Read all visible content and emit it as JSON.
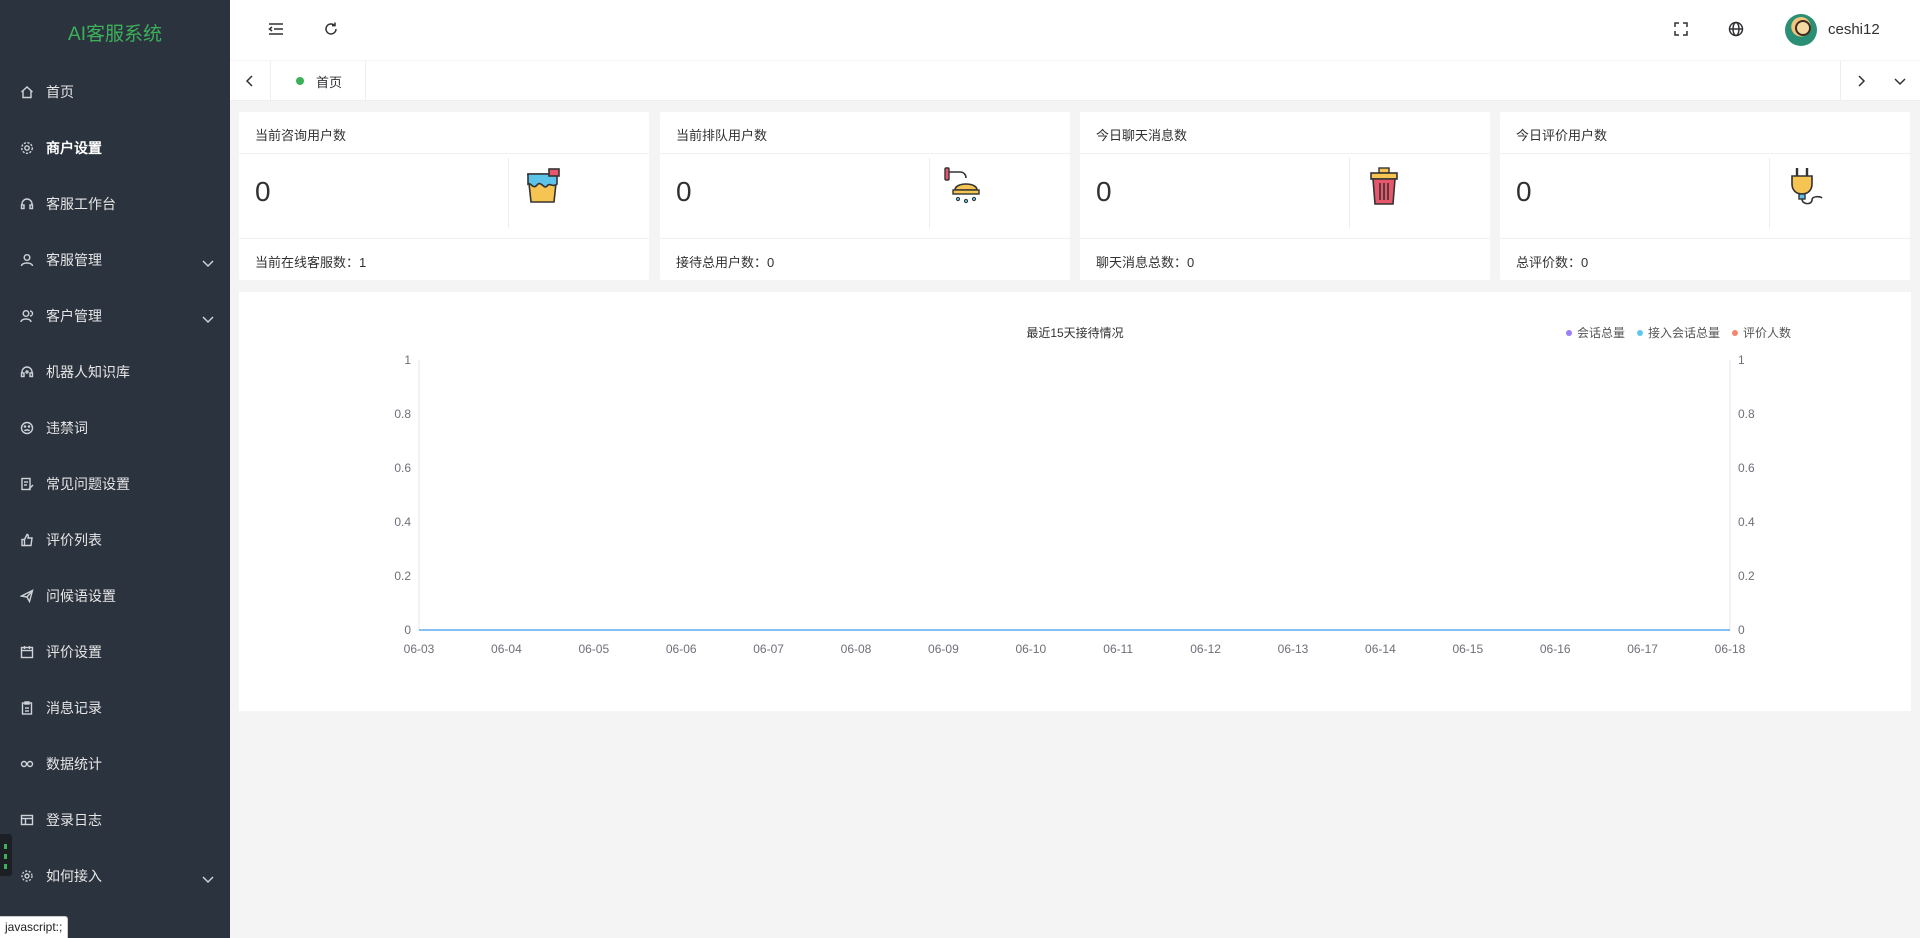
{
  "app": {
    "title": "AI客服系统"
  },
  "sidebar": {
    "items": [
      {
        "label": "首页",
        "icon": "home-icon",
        "active": false,
        "expandable": false
      },
      {
        "label": "商户设置",
        "icon": "gear-icon",
        "active": true,
        "expandable": false
      },
      {
        "label": "客服工作台",
        "icon": "headset-icon",
        "active": false,
        "expandable": false
      },
      {
        "label": "客服管理",
        "icon": "user-icon",
        "active": false,
        "expandable": true
      },
      {
        "label": "客户管理",
        "icon": "customer-icon",
        "active": false,
        "expandable": true
      },
      {
        "label": "机器人知识库",
        "icon": "robot-icon",
        "active": false,
        "expandable": false
      },
      {
        "label": "违禁词",
        "icon": "sad-face-icon",
        "active": false,
        "expandable": false
      },
      {
        "label": "常见问题设置",
        "icon": "edit-doc-icon",
        "active": false,
        "expandable": false
      },
      {
        "label": "评价列表",
        "icon": "thumb-up-icon",
        "active": false,
        "expandable": false
      },
      {
        "label": "问候语设置",
        "icon": "send-icon",
        "active": false,
        "expandable": false
      },
      {
        "label": "评价设置",
        "icon": "calendar-icon",
        "active": false,
        "expandable": false
      },
      {
        "label": "消息记录",
        "icon": "clipboard-icon",
        "active": false,
        "expandable": false
      },
      {
        "label": "数据统计",
        "icon": "link-icon",
        "active": false,
        "expandable": false
      },
      {
        "label": "登录日志",
        "icon": "window-icon",
        "active": false,
        "expandable": false
      },
      {
        "label": "如何接入",
        "icon": "gear-outline-icon",
        "active": false,
        "expandable": true
      }
    ]
  },
  "status_bar": {
    "text": "javascript:;"
  },
  "header": {
    "username": "ceshi12"
  },
  "tabs": {
    "items": [
      {
        "label": "首页"
      }
    ]
  },
  "cards": [
    {
      "title": "当前咨询用户数",
      "value": "0",
      "footer": "当前在线客服数：1",
      "icon": "paint-bucket-icon"
    },
    {
      "title": "当前排队用户数",
      "value": "0",
      "footer": "接待总用户数：0",
      "icon": "shower-icon"
    },
    {
      "title": "今日聊天消息数",
      "value": "0",
      "footer": "聊天消息总数：0",
      "icon": "trash-can-icon"
    },
    {
      "title": "今日评价用户数",
      "value": "0",
      "footer": "总评价数：0",
      "icon": "plug-icon"
    }
  ],
  "chart_data": {
    "type": "line",
    "title": "最近15天接待情况",
    "x": [
      "06-03",
      "06-04",
      "06-05",
      "06-06",
      "06-07",
      "06-08",
      "06-09",
      "06-10",
      "06-11",
      "06-12",
      "06-13",
      "06-14",
      "06-15",
      "06-16",
      "06-17",
      "06-18"
    ],
    "series": [
      {
        "name": "会话总量",
        "color": "#9b7ef5",
        "values": [
          0,
          0,
          0,
          0,
          0,
          0,
          0,
          0,
          0,
          0,
          0,
          0,
          0,
          0,
          0,
          0
        ]
      },
      {
        "name": "接入会话总量",
        "color": "#5cc8ee",
        "values": [
          0,
          0,
          0,
          0,
          0,
          0,
          0,
          0,
          0,
          0,
          0,
          0,
          0,
          0,
          0,
          0
        ]
      },
      {
        "name": "评价人数",
        "color": "#f4866e",
        "values": [
          0,
          0,
          0,
          0,
          0,
          0,
          0,
          0,
          0,
          0,
          0,
          0,
          0,
          0,
          0,
          0
        ]
      }
    ],
    "y_ticks": [
      "0",
      "0.2",
      "0.4",
      "0.6",
      "0.8",
      "1"
    ],
    "ylim": [
      0,
      1
    ],
    "y2lim": [
      0,
      1
    ],
    "legend_position": "top-right",
    "grid": false
  }
}
